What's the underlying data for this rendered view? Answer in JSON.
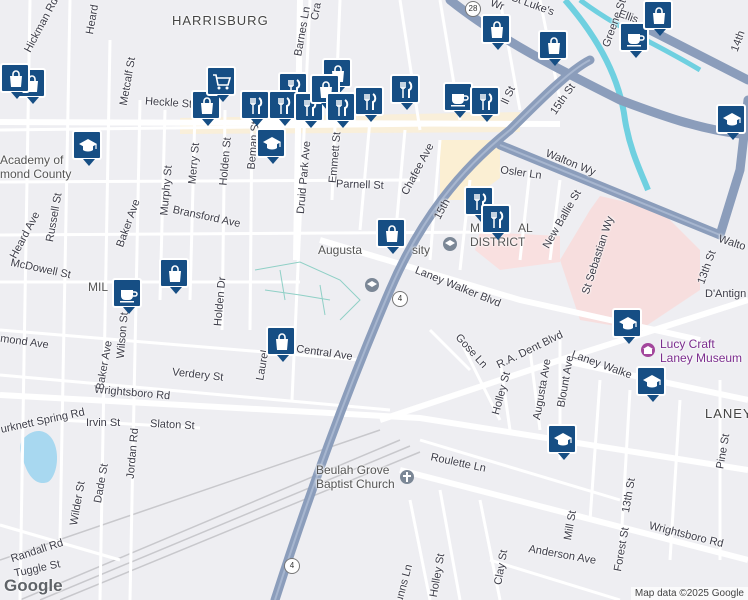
{
  "map": {
    "attribution": "Map data ©2025 Google",
    "logo": "Google",
    "colors": {
      "background": "#eeeef2",
      "road": "#ffffff",
      "highway": "#8b9dbb",
      "water": "#6fd0e0",
      "lake": "#a8d8f0",
      "campus": "#f7dede",
      "commercial": "#fbefd3",
      "pin": "#164e84"
    }
  },
  "labels": {
    "harrisburg": "HARRISBURG",
    "laney": "LANEY",
    "academy1": "Academy of",
    "academy2": "mond County",
    "milledgeville": "MIL",
    "augusta_univ_a": "Augusta",
    "augusta_univ_b": "sity",
    "medical_district_a": "M",
    "medical_district_b": "AL",
    "medical_district_c": "DISTRICT",
    "beulah1": "Beulah Grove",
    "beulah2": "Baptist Church",
    "lucy1": "Lucy Craft",
    "lucy2": "Laney Museum",
    "dantign": "D'Antign",
    "walton_r": "Walto",
    "streets": {
      "hickman": "Hickman Rd",
      "heard_top": "Heard",
      "metcalf": "Metcalf St",
      "heckle": "Heckle St",
      "russell": "Russell St",
      "heard_ave": "Heard Ave",
      "baker": "Baker Ave",
      "murphy": "Murphy St",
      "merry": "Merry St",
      "holden": "Holden St",
      "beman": "Beman St",
      "druid": "Druid Park Ave",
      "emmett": "Emmett St",
      "parnell": "Parnell St",
      "chafee": "Chafee Ave",
      "bransford": "Bransford Ave",
      "mcdowell": "McDowell St",
      "wilson": "Wilson St",
      "holden_dr": "Holden Dr",
      "richmond": "mond Ave",
      "central": "Central Ave",
      "laurel": "Laurel",
      "verdery": "Verdery St",
      "wrightsboro": "Wrightsboro Rd",
      "burknett": "urknett Spring Rd",
      "irvin": "Irvin St",
      "slaton": "Slaton St",
      "jordan": "Jordan Rd",
      "baker_bottom": "Baker Ave",
      "wilder": "Wilder St",
      "dade": "Dade St",
      "randall": "Randall Rd",
      "tuggle": "Tuggle St",
      "barnes": "Barnes Ln",
      "cra": "Cra",
      "fifteenth_a": "15th",
      "fifteenth_b": "15th St",
      "fifteenth_c": "15th St",
      "stlukes": "St Luke's",
      "greene": "Greene St",
      "ellis": "Ellis",
      "fourteenth": "14th",
      "walton_wy": "Walton Wy",
      "osler": "Osler Ln",
      "new_ballie": "New Ballie St",
      "st_sebastian": "St Sebastian Wy",
      "thirteenth": "13th St",
      "laney_walker": "Laney Walker Blvd",
      "laney_walker_b": "Laney Walke",
      "rad_dent": "R.A. Dent Blvd",
      "gose": "Gose Ln",
      "holley": "Holley St",
      "augusta_ave": "Augusta Ave",
      "blount": "Blount Ave",
      "roulette": "Roulette Ln",
      "pine": "Pine St",
      "mill": "Mill St",
      "forest": "Forest St",
      "thirteenth_b": "13th St",
      "wrightsboro_b": "Wrightsboro Rd",
      "anderson": "Anderson Ave",
      "clay": "Clay St",
      "holley_b": "Holley St",
      "dunns": "Dunns Ln",
      "wr_top": "Wr",
      "ll_st": "ll St"
    },
    "shields": {
      "r28": "28",
      "r4a": "4",
      "r4b": "4"
    }
  },
  "pins": [
    {
      "type": "shopping",
      "icon": "bag-icon"
    },
    {
      "type": "shopping",
      "icon": "bag-icon"
    },
    {
      "type": "shopping",
      "icon": "bag-icon"
    },
    {
      "type": "cafe",
      "icon": "cup-icon"
    },
    {
      "type": "shopping",
      "icon": "bag-icon"
    },
    {
      "type": "grocery",
      "icon": "cart-icon"
    },
    {
      "type": "shopping",
      "icon": "bag-icon"
    },
    {
      "type": "restaurant",
      "icon": "fork-knife-icon"
    },
    {
      "type": "restaurant",
      "icon": "fork-knife-icon"
    },
    {
      "type": "restaurant",
      "icon": "fork-knife-icon"
    },
    {
      "type": "restaurant",
      "icon": "fork-knife-icon"
    },
    {
      "type": "shopping",
      "icon": "bag-icon"
    },
    {
      "type": "restaurant",
      "icon": "fork-knife-icon"
    },
    {
      "type": "restaurant",
      "icon": "fork-knife-icon"
    },
    {
      "type": "restaurant",
      "icon": "fork-knife-icon"
    },
    {
      "type": "cafe",
      "icon": "cup-icon"
    },
    {
      "type": "restaurant",
      "icon": "fork-knife-icon"
    },
    {
      "type": "school",
      "icon": "school-icon"
    },
    {
      "type": "school",
      "icon": "school-icon"
    },
    {
      "type": "school",
      "icon": "school-icon"
    },
    {
      "type": "shopping",
      "icon": "bag-icon"
    },
    {
      "type": "shopping",
      "icon": "bag-icon"
    },
    {
      "type": "cafe",
      "icon": "cup-icon"
    },
    {
      "type": "shopping",
      "icon": "bag-icon"
    },
    {
      "type": "restaurant",
      "icon": "fork-knife-icon"
    },
    {
      "type": "restaurant",
      "icon": "fork-knife-icon"
    },
    {
      "type": "shopping",
      "icon": "bag-icon"
    },
    {
      "type": "school",
      "icon": "school-icon"
    },
    {
      "type": "school",
      "icon": "school-icon"
    },
    {
      "type": "school",
      "icon": "school-icon"
    },
    {
      "type": "shopping",
      "icon": "bag-icon"
    }
  ]
}
